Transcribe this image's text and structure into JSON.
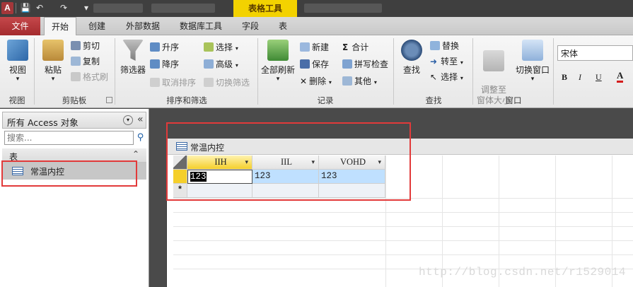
{
  "quick_access": {
    "app_icon": "A",
    "context_group": "表格工具"
  },
  "ribbon_tabs": [
    "文件",
    "开始",
    "创建",
    "外部数据",
    "数据库工具",
    "字段",
    "表"
  ],
  "ribbon": {
    "view": {
      "label": "视图",
      "group": "视图"
    },
    "clipboard": {
      "paste": "粘贴",
      "cut": "剪切",
      "copy": "复制",
      "format_painter": "格式刷",
      "group": "剪贴板"
    },
    "sort_filter": {
      "filter": "筛选器",
      "ascending": "升序",
      "descending": "降序",
      "remove_sort": "取消排序",
      "selection": "选择",
      "advanced": "高级",
      "toggle_filter": "切换筛选",
      "group": "排序和筛选"
    },
    "records": {
      "refresh_all": "全部刷新",
      "new": "新建",
      "save": "保存",
      "delete": "删除",
      "totals": "合计",
      "spelling": "拼写检查",
      "more": "其他",
      "group": "记录"
    },
    "find": {
      "find": "查找",
      "replace": "替换",
      "goto": "转至",
      "select": "选择",
      "group": "查找"
    },
    "window": {
      "size_to_fit": "调整至\n窗体大小",
      "switch_windows": "切换窗口",
      "group": "窗口"
    },
    "text_format": {
      "font": "宋体",
      "bold": "B",
      "italic": "I",
      "underline": "U",
      "font_color": "A"
    }
  },
  "nav_pane": {
    "title": "所有 Access 对象",
    "search_placeholder": "搜索...",
    "section": "表",
    "items": [
      {
        "label": "常温内控"
      }
    ]
  },
  "document": {
    "title": "常温内控",
    "columns": [
      "IIH",
      "IIL",
      "VOHD"
    ],
    "rows": [
      [
        "123",
        "123",
        "123"
      ]
    ],
    "new_row_marker": "*"
  },
  "watermark": "http://blog.csdn.net/r1529014",
  "colors": {
    "file_tab": "#a42b2e",
    "context_tab": "#f3d200",
    "selection_row": "#bfe0ff",
    "annotation_red": "#e23a3a"
  }
}
